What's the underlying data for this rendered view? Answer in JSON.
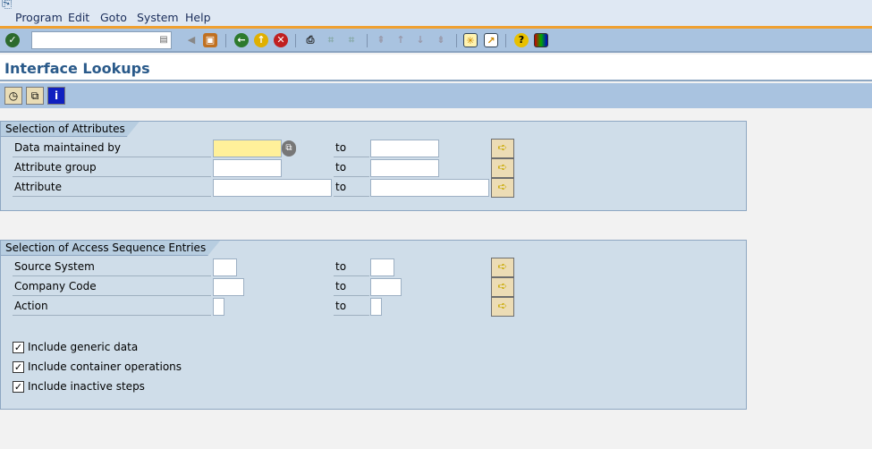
{
  "menu": [
    "Program",
    "Edit",
    "Goto",
    "System",
    "Help"
  ],
  "toolbar": {
    "command_field": "",
    "icons": [
      "enter-icon",
      "command-history-icon",
      "back-nav-icon",
      "save-icon",
      "back-icon",
      "exit-icon",
      "cancel-icon",
      "print-icon",
      "find-icon",
      "find-next-icon",
      "first-page-icon",
      "prev-page-icon",
      "next-page-icon",
      "last-page-icon",
      "new-session-icon",
      "shortcut-icon",
      "help-icon",
      "layout-icon"
    ]
  },
  "title": "Interface Lookups",
  "app_toolbar": [
    "execute-icon",
    "get-variant-icon",
    "info-icon"
  ],
  "group1": {
    "title": "Selection of Attributes",
    "to_label": "to",
    "rows": [
      {
        "label": "Data maintained by",
        "from": "",
        "to": ""
      },
      {
        "label": "Attribute group",
        "from": "",
        "to": ""
      },
      {
        "label": "Attribute",
        "from": "",
        "to": ""
      }
    ]
  },
  "group2": {
    "title": "Selection of Access Sequence Entries",
    "to_label": "to",
    "rows": [
      {
        "label": "Source System",
        "from": "",
        "to": ""
      },
      {
        "label": "Company Code",
        "from": "",
        "to": ""
      },
      {
        "label": "Action",
        "from": "",
        "to": ""
      }
    ],
    "checkboxes": [
      {
        "label": "Include generic data",
        "checked": true
      },
      {
        "label": "Include container operations",
        "checked": true
      },
      {
        "label": "Include inactive steps",
        "checked": true
      }
    ]
  },
  "colors": {
    "accent_orange": "#f0a030",
    "title": "#2a5a8a",
    "required_field": "#fff09a"
  }
}
